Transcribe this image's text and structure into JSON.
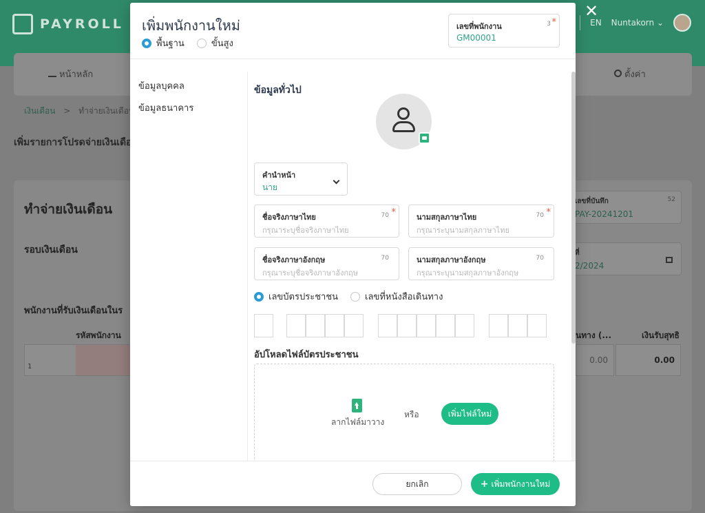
{
  "app": {
    "logo_text": "PAYROLL",
    "lang": "EN",
    "user_name": "Nuntakorn",
    "user_chevron": "⌄",
    "close_glyph": "✕"
  },
  "nav": {
    "home": "หน้าหลัก",
    "settings": "ตั้งค่า"
  },
  "breadcrumb": {
    "root": "เงินเดือน",
    "sep": ">",
    "current": "ทำจ่ายเงินเดือน"
  },
  "page": {
    "heading": "เพิ่มรายการโปรดจ่ายเงินเดือน",
    "card_title": "ทำจ่ายเงินเดือน",
    "round_label": "รอบเงินเดือน",
    "employees_label": "พนักงานที่รับเงินเดือนในร",
    "col_employee_code": "รหัสพนักงาน",
    "col_passport": "นทาง (...",
    "col_net": "เงินรับสุทธิ",
    "row_number": "1",
    "row_passport_value": "0.00",
    "row_net_value": "0.00",
    "record_no_label": "เลขที่บันทึก",
    "record_no_value": "PAY-20241201",
    "record_no_count": "52",
    "date_label": "ที่",
    "date_value": "2/2024"
  },
  "modal": {
    "title": "เพิ่มพนักงานใหม่",
    "mode_basic": "พื้นฐาน",
    "mode_advanced": "ขั้นสูง",
    "employee_no": {
      "label": "เลขที่พนักงาน",
      "count": "3",
      "value": "GM00001",
      "required": "*"
    },
    "sidebar": [
      "ข้อมูลบุคคล",
      "ข้อมูลธนาคาร"
    ],
    "section_title": "ข้อมูลทั่วไป",
    "prefix": {
      "label": "คำนำหน้า",
      "value": "นาย"
    },
    "first_name_th": {
      "label": "ชื่อจริงภาษาไทย",
      "count": "70",
      "placeholder": "กรุณาระบุชื่อจริงภาษาไทย",
      "required": "*"
    },
    "last_name_th": {
      "label": "นามสกุลภาษาไทย",
      "count": "70",
      "placeholder": "กรุณาระบุนามสกุลภาษาไทย",
      "required": "*"
    },
    "first_name_en": {
      "label": "ชื่อจริงภาษาอังกฤษ",
      "count": "70",
      "placeholder": "กรุณาระบุชื่อจริงภาษาอังกฤษ"
    },
    "last_name_en": {
      "label": "นามสกุลภาษาอังกฤษ",
      "count": "70",
      "placeholder": "กรุณาระบุนามสกุลภาษาอังกฤษ"
    },
    "id_type_citizen": "เลขบัตรประชาชน",
    "id_type_passport": "เลขที่หนังสือเดินทาง",
    "upload_title": "อัปโหลดไฟล์บัตรประชาชน",
    "drag_text": "ลากไฟล์มาวาง",
    "or_text": "หรือ",
    "add_file": "เพิ่มไฟล์ใหม่",
    "cancel": "ยกเลิก",
    "submit": "เพิ่มพนักงานใหม่",
    "submit_icon": "+"
  },
  "colors": {
    "header_green": "#2f8a6a",
    "accent_green": "#1ebc86",
    "radio_blue": "#2c9bd6",
    "required_red": "#e05a3a"
  }
}
